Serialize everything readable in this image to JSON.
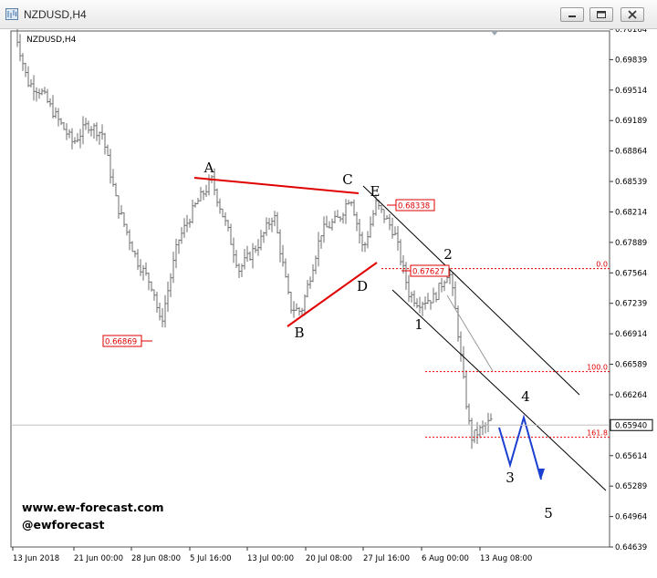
{
  "window": {
    "title": "NZDUSD,H4",
    "buttons": {
      "minimize": "minimize",
      "maximize": "maximize",
      "close": "close"
    }
  },
  "chart_data": {
    "type": "ohlc",
    "symbol_label": "NZDUSD,H4",
    "current_price": "0.65940",
    "y_ticks": [
      "0.70164",
      "0.69839",
      "0.69514",
      "0.69189",
      "0.68864",
      "0.68539",
      "0.68214",
      "0.67889",
      "0.67564",
      "0.67239",
      "0.66914",
      "0.66589",
      "0.66264",
      "0.65940",
      "0.65614",
      "0.65289",
      "0.64964",
      "0.64639"
    ],
    "ylim": [
      0.64639,
      0.70164
    ],
    "x_ticks": [
      "13 Jun 2018",
      "21 Jun 00:00",
      "28 Jun 08:00",
      "5 Jul 16:00",
      "13 Jul 00:00",
      "20 Jul 08:00",
      "27 Jul 16:00",
      "6 Aug 00:00",
      "13 Aug 08:00"
    ],
    "price_path": [
      [
        "13 Jun 2018",
        0.7018
      ],
      [
        "21 Jun 00:00",
        0.6915
      ],
      [
        "28 Jun 08:00",
        0.67
      ],
      [
        "5 Jul 16:00",
        0.685
      ],
      [
        "13 Jul 00:00",
        0.673
      ],
      [
        "20 Jul 08:00",
        0.6805
      ],
      [
        "27 Jul 16:00",
        0.6826
      ],
      [
        "6 Aug 00:00",
        0.674
      ],
      [
        "13 Aug 08:00",
        0.658
      ]
    ],
    "price_labels": [
      "0.68338",
      "0.67627",
      "0.66869"
    ],
    "fib_levels": [
      {
        "label": "0.0",
        "price": 0.6761
      },
      {
        "label": "100.0",
        "price": 0.6651
      },
      {
        "label": "161.8",
        "price": 0.6581
      }
    ],
    "wave_labels": [
      "A",
      "B",
      "C",
      "D",
      "E",
      "1",
      "2",
      "3",
      "4",
      "5"
    ],
    "watermark": [
      "www.ew-forecast.com",
      "@ewforecast"
    ],
    "colors": {
      "candles": "#6e6e6e",
      "annotation": "#e00000",
      "projection": "#1a3fd1",
      "channel": "#000000"
    }
  }
}
